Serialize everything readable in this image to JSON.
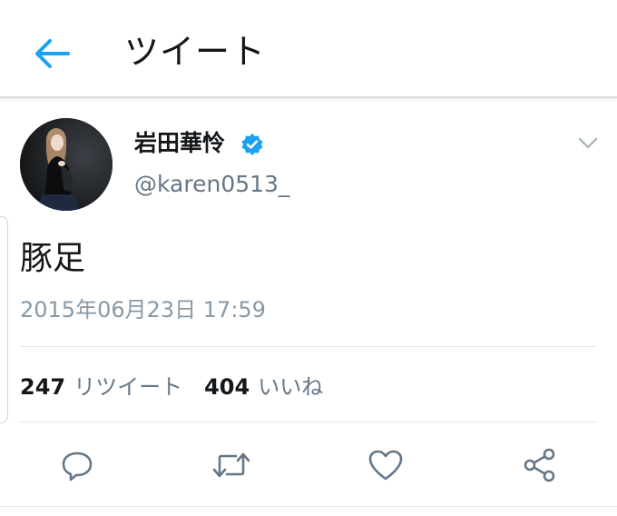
{
  "header": {
    "title": "ツイート",
    "back_icon": "arrow-left-icon"
  },
  "tweet": {
    "author": {
      "name": "岩田華怜",
      "handle": "@karen0513_",
      "verified": true
    },
    "text": "豚足",
    "timestamp": "2015年06月23日 17:59",
    "stats": {
      "retweets_count": "247",
      "retweets_label": "リツイート",
      "likes_count": "404",
      "likes_label": "いいね"
    },
    "actions": [
      "reply-icon",
      "retweet-icon",
      "like-icon",
      "share-icon"
    ]
  },
  "colors": {
    "accent": "#1da1f2",
    "text_primary": "#14171a",
    "text_secondary": "#657786",
    "divider": "#e1e8ed"
  }
}
